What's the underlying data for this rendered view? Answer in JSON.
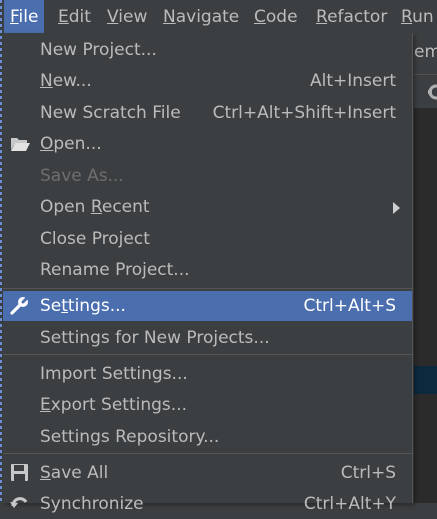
{
  "menubar": {
    "file": {
      "mnemonic": "F",
      "rest": "ile"
    },
    "edit": {
      "mnemonic": "E",
      "rest": "dit"
    },
    "view": {
      "mnemonic": "V",
      "rest": "iew"
    },
    "navigate": {
      "mnemonic": "N",
      "rest": "avigate"
    },
    "code": {
      "mnemonic": "C",
      "rest": "ode"
    },
    "refactor": {
      "mnemonic": "R",
      "rest": "efactor"
    },
    "run": {
      "mnemonic": "R",
      "rest": "un"
    }
  },
  "background": {
    "tab_fragment": "em"
  },
  "file_menu": {
    "new_project": {
      "label": "New Project..."
    },
    "new": {
      "mnemonic": "N",
      "rest": "ew...",
      "shortcut": "Alt+Insert"
    },
    "new_scratch": {
      "label": "New Scratch File",
      "shortcut": "Ctrl+Alt+Shift+Insert"
    },
    "open": {
      "mnemonic": "O",
      "rest": "pen..."
    },
    "save_as": {
      "label": "Save As..."
    },
    "open_recent": {
      "before": "Open ",
      "mnemonic": "R",
      "rest": "ecent"
    },
    "close_project": {
      "label": "Close Project"
    },
    "rename_project": {
      "label": "Rename Project..."
    },
    "settings": {
      "before": "Se",
      "mnemonic": "t",
      "rest": "tings...",
      "shortcut": "Ctrl+Alt+S"
    },
    "settings_new_projects": {
      "label": "Settings for New Projects..."
    },
    "import_settings": {
      "label": "Import Settings..."
    },
    "export_settings": {
      "mnemonic": "E",
      "rest": "xport Settings..."
    },
    "settings_repository": {
      "label": "Settings Repository..."
    },
    "save_all": {
      "mnemonic": "S",
      "rest": "ave All",
      "shortcut": "Ctrl+S"
    },
    "synchronize": {
      "label": "Synchronize",
      "shortcut": "Ctrl+Alt+Y"
    }
  },
  "colors": {
    "background": "#3c3f41",
    "selection": "#4b6eaf",
    "text": "#bbbbbb",
    "disabled_text": "#6e6e6e",
    "separator": "#555555"
  }
}
